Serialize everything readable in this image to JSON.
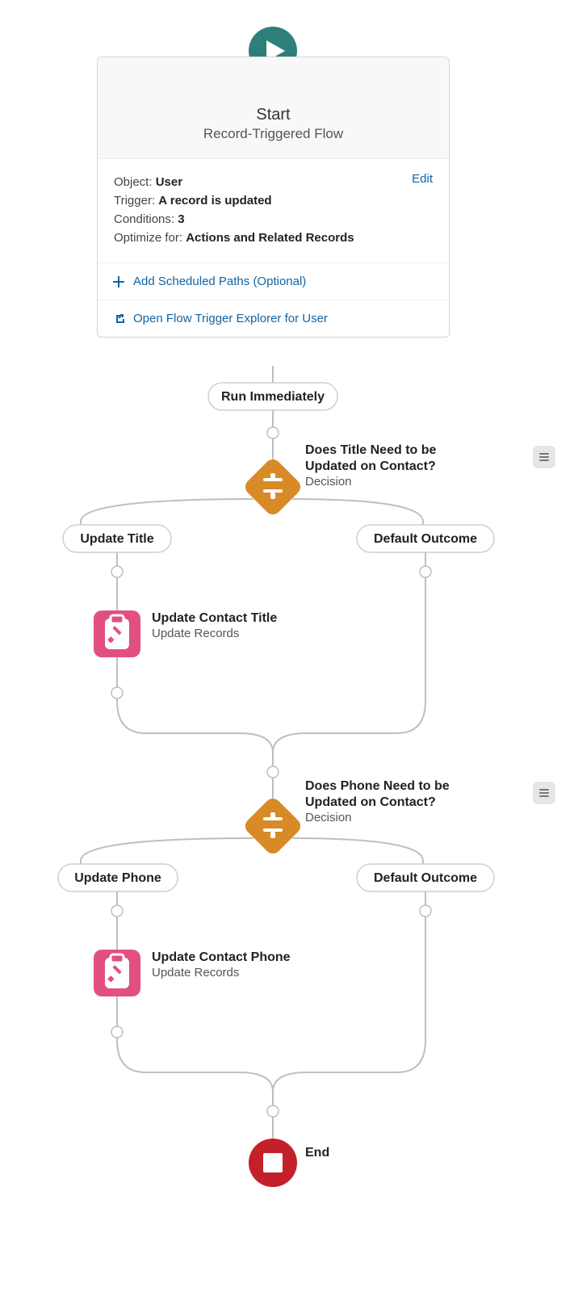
{
  "start": {
    "title": "Start",
    "subtitle": "Record-Triggered Flow",
    "object_label": "Object:",
    "object_value": "User",
    "trigger_label": "Trigger:",
    "trigger_value": "A record is updated",
    "conditions_label": "Conditions:",
    "conditions_value": "3",
    "optimize_label": "Optimize for:",
    "optimize_value": "Actions and Related Records",
    "edit_label": "Edit",
    "add_paths": "Add Scheduled Paths (Optional)",
    "open_explorer": "Open Flow Trigger Explorer for User"
  },
  "run_immediately": "Run Immediately",
  "decisions": [
    {
      "title_line1": "Does Title Need to be",
      "title_line2": "Updated on Contact?",
      "type": "Decision",
      "left_outcome": "Update Title",
      "right_outcome": "Default Outcome",
      "action_title": "Update Contact Title",
      "action_type": "Update Records"
    },
    {
      "title_line1": "Does Phone Need to be",
      "title_line2": "Updated on Contact?",
      "type": "Decision",
      "left_outcome": "Update Phone",
      "right_outcome": "Default Outcome",
      "action_title": "Update Contact Phone",
      "action_type": "Update Records"
    }
  ],
  "end_label": "End",
  "colors": {
    "start_icon": "#2e7f7a",
    "decision": "#d78a26",
    "update": "#e25082",
    "end": "#c42029",
    "link": "#1264a3",
    "wire": "#bfbfbf"
  }
}
